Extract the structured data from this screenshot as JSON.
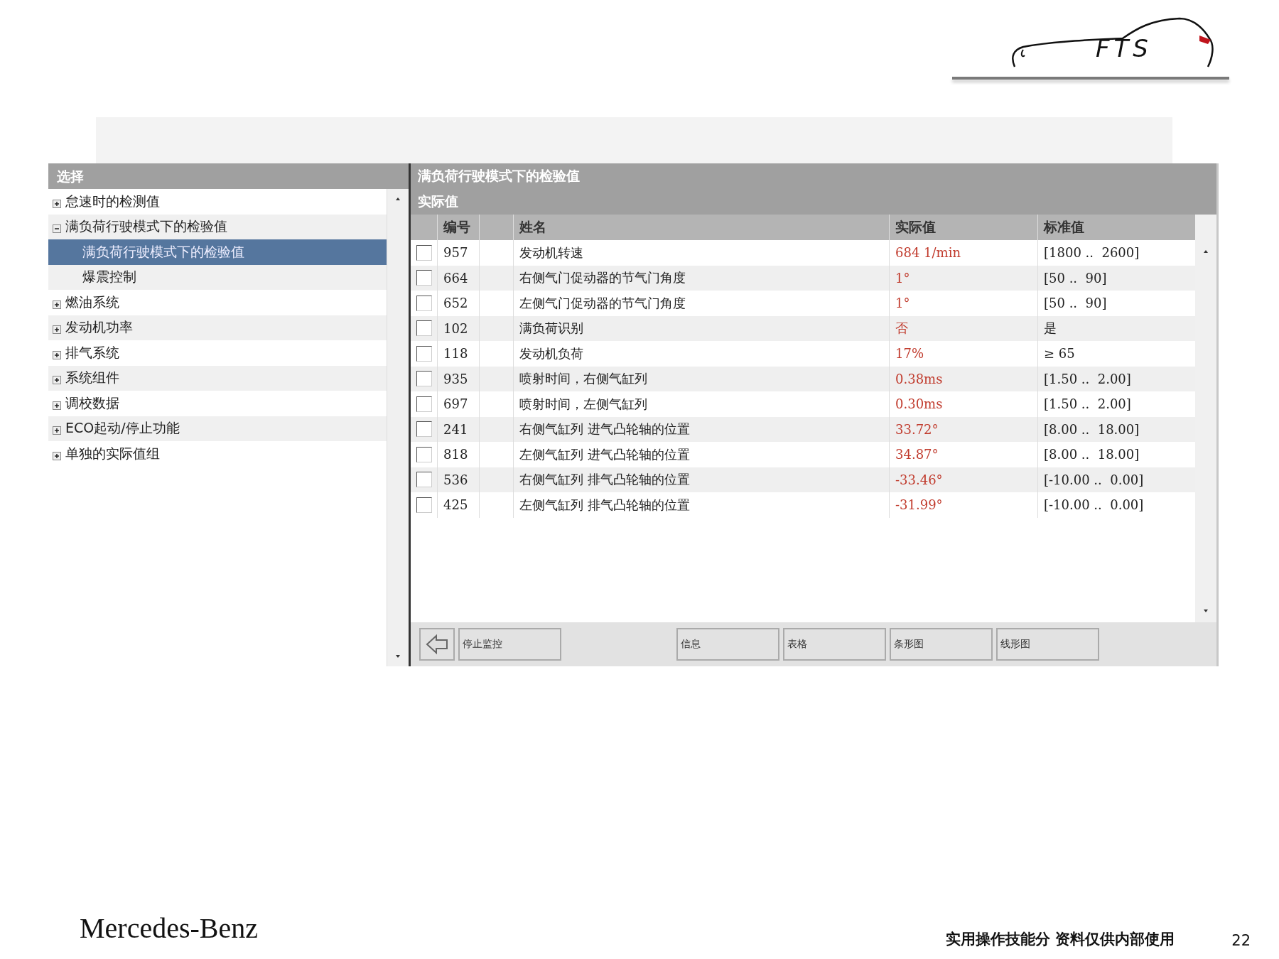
{
  "logo": {
    "text": "FTS"
  },
  "tree": {
    "title": "选择",
    "items": [
      {
        "label": "怠速时的检测值",
        "expanded": false,
        "selected": false
      },
      {
        "label": "满负荷行驶模式下的检验值",
        "expanded": true,
        "selected": false,
        "children": [
          {
            "label": "满负荷行驶模式下的检验值",
            "selected": true
          },
          {
            "label": "爆震控制",
            "selected": false
          }
        ]
      },
      {
        "label": "燃油系统",
        "expanded": false,
        "selected": false
      },
      {
        "label": "发动机功率",
        "expanded": false,
        "selected": false
      },
      {
        "label": "排气系统",
        "expanded": false,
        "selected": false
      },
      {
        "label": "系统组件",
        "expanded": false,
        "selected": false
      },
      {
        "label": "调校数据",
        "expanded": false,
        "selected": false
      },
      {
        "label": "ECO起动/停止功能",
        "expanded": false,
        "selected": false
      },
      {
        "label": "单独的实际值组",
        "expanded": false,
        "selected": false
      }
    ]
  },
  "panel": {
    "title": "满负荷行驶模式下的检验值",
    "subtitle": "实际值"
  },
  "table": {
    "columns": [
      "编号",
      "姓名",
      "实际值",
      "标准值"
    ],
    "rows": [
      {
        "checked": false,
        "number": "957",
        "name": "发动机转速",
        "actual": "684 1/min",
        "standard": "[1800 ..  2600]"
      },
      {
        "checked": false,
        "number": "664",
        "name": "右侧气门促动器的节气门角度",
        "actual": "1°",
        "standard": "[50 ..  90]"
      },
      {
        "checked": false,
        "number": "652",
        "name": "左侧气门促动器的节气门角度",
        "actual": "1°",
        "standard": "[50 ..  90]"
      },
      {
        "checked": false,
        "number": "102",
        "name": "满负荷识别",
        "actual": "否",
        "standard": "是"
      },
      {
        "checked": false,
        "number": "118",
        "name": "发动机负荷",
        "actual": "17%",
        "standard": "≥ 65"
      },
      {
        "checked": false,
        "number": "935",
        "name": "喷射时间，右侧气缸列",
        "actual": "0.38ms",
        "standard": "[1.50 ..  2.00]"
      },
      {
        "checked": false,
        "number": "697",
        "name": "喷射时间，左侧气缸列",
        "actual": "0.30ms",
        "standard": "[1.50 ..  2.00]"
      },
      {
        "checked": false,
        "number": "241",
        "name": "右侧气缸列 进气凸轮轴的位置",
        "actual": "33.72°",
        "standard": "[8.00 ..  18.00]"
      },
      {
        "checked": false,
        "number": "818",
        "name": "左侧气缸列 进气凸轮轴的位置",
        "actual": "34.87°",
        "standard": "[8.00 ..  18.00]"
      },
      {
        "checked": false,
        "number": "536",
        "name": "右侧气缸列 排气凸轮轴的位置",
        "actual": "-33.46°",
        "standard": "[-10.00 ..  0.00]"
      },
      {
        "checked": false,
        "number": "425",
        "name": "左侧气缸列 排气凸轮轴的位置",
        "actual": "-31.99°",
        "standard": "[-10.00 ..  0.00]"
      }
    ]
  },
  "toolbar": {
    "buttons": [
      {
        "kind": "icon"
      },
      {
        "kind": "text",
        "label": "停止监控"
      },
      {
        "kind": "gap"
      },
      {
        "kind": "text",
        "label": "信息"
      },
      {
        "kind": "text",
        "label": "表格"
      },
      {
        "kind": "text",
        "label": "条形图"
      },
      {
        "kind": "text",
        "label": "线形图"
      }
    ]
  },
  "footer": {
    "brand": "Mercedes-Benz",
    "note": "实用操作技能分 资料仅供内部使用",
    "page": "22"
  }
}
